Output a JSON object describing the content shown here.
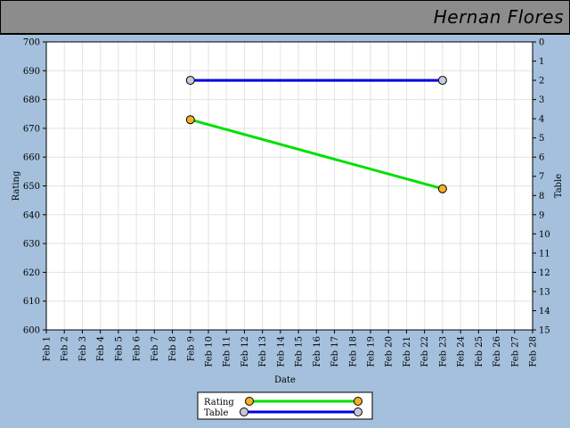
{
  "header": {
    "name": "Hernan Flores"
  },
  "chart_data": {
    "type": "line",
    "xlabel": "Date",
    "ylabel_left": "Rating",
    "ylabel_right": "Table",
    "x_categories": [
      "Feb 1",
      "Feb 2",
      "Feb 3",
      "Feb 4",
      "Feb 5",
      "Feb 6",
      "Feb 7",
      "Feb 8",
      "Feb 9",
      "Feb 10",
      "Feb 11",
      "Feb 12",
      "Feb 13",
      "Feb 14",
      "Feb 15",
      "Feb 16",
      "Feb 17",
      "Feb 18",
      "Feb 19",
      "Feb 20",
      "Feb 21",
      "Feb 22",
      "Feb 23",
      "Feb 24",
      "Feb 25",
      "Feb 26",
      "Feb 27",
      "Feb 28"
    ],
    "ylim_left": [
      600,
      700
    ],
    "ylim_right": [
      15,
      0
    ],
    "yticks_left": [
      600,
      610,
      620,
      630,
      640,
      650,
      660,
      670,
      680,
      690,
      700
    ],
    "yticks_right": [
      0,
      1,
      2,
      3,
      4,
      5,
      6,
      7,
      8,
      9,
      10,
      11,
      12,
      13,
      14,
      15
    ],
    "grid": true,
    "legend_position": "bottom-center",
    "series": [
      {
        "name": "Rating",
        "axis": "left",
        "color": "#00e000",
        "marker_color": "#f8b020",
        "points": [
          {
            "x": "Feb 9",
            "y": 673
          },
          {
            "x": "Feb 23",
            "y": 649
          }
        ]
      },
      {
        "name": "Table",
        "axis": "right",
        "color": "#0000e0",
        "marker_color": "#c8c8dc",
        "points": [
          {
            "x": "Feb 9",
            "y": 2
          },
          {
            "x": "Feb 23",
            "y": 2
          }
        ]
      }
    ]
  }
}
